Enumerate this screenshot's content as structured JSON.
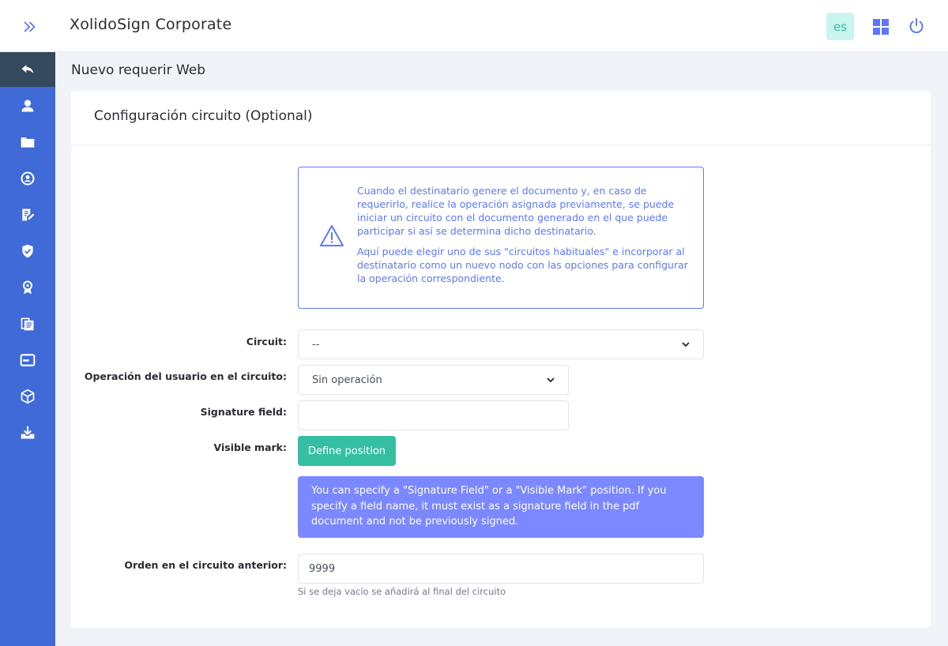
{
  "header": {
    "app_title": "XolidoSign Corporate",
    "lang_label": "es",
    "icons": [
      "double-chevron-right-icon",
      "grid-icon",
      "power-icon"
    ]
  },
  "sidebar": {
    "items": [
      {
        "icon": "back-arrow-icon",
        "active": true
      },
      {
        "icon": "user-icon",
        "active": false
      },
      {
        "icon": "folder-icon",
        "active": false
      },
      {
        "icon": "user-circle-icon",
        "active": false
      },
      {
        "icon": "document-edit-icon",
        "active": false
      },
      {
        "icon": "shield-check-icon",
        "active": false
      },
      {
        "icon": "certificate-icon",
        "active": false
      },
      {
        "icon": "documents-icon",
        "active": false
      },
      {
        "icon": "window-icon",
        "active": false
      },
      {
        "icon": "box-icon",
        "active": false
      },
      {
        "icon": "download-tray-icon",
        "active": false
      }
    ]
  },
  "page": {
    "title": "Nuevo requerir Web"
  },
  "card": {
    "title": "Configuración circuito (Optional)",
    "alert": {
      "paragraph1": "Cuando el destinatario genere el documento y, en caso de requerirlo, realice la operación asignada previamente, se puede iniciar un circuito con el documento generado en el que puede participar si así se determina dicho destinatario.",
      "paragraph2": "Aquí puede elegir uno de sus \"circuitos habituales\" e incorporar al destinatario como un nuevo nodo con las opciones para configurar la operación correspondiente."
    },
    "form": {
      "circuit_label": "Circuit:",
      "circuit_value": "--",
      "operation_label": "Operación del usuario en el circuito:",
      "operation_value": "Sin operación",
      "signature_field_label": "Signature field:",
      "signature_field_value": "",
      "visible_mark_label": "Visible mark:",
      "define_position_button": "Define position",
      "info_text": "You can specify a \"Signature Field\" or a \"Visible Mark\" position. If you specify a field name, it must exist as a signature field in the pdf document and not be previously signed.",
      "order_label": "Orden en el circuito anterior:",
      "order_value": "9999",
      "order_hint": "Si se deja vacío se añadirá al final del circuito"
    }
  },
  "colors": {
    "sidebar_bg": "#3f6ad8",
    "sidebar_active": "#34495e",
    "accent_blue": "#5d78ff",
    "success_teal": "#34bfa3",
    "info_box_bg": "#7b88ff"
  }
}
